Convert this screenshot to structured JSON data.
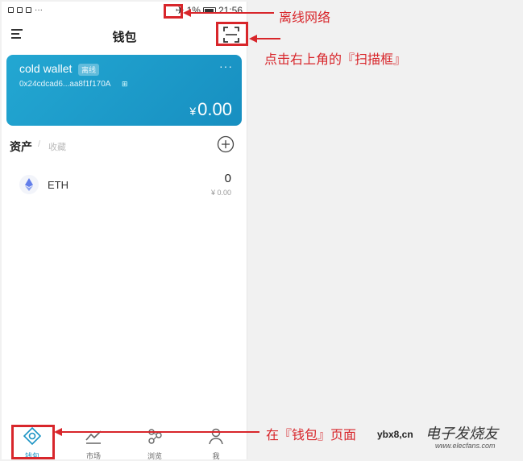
{
  "status_bar": {
    "left_icons": [
      "sim-icon",
      "message-icon",
      "image-icon"
    ],
    "dots": "···",
    "signal": "1%",
    "time": "21:56"
  },
  "header": {
    "title": "钱包"
  },
  "card": {
    "name": "cold wallet",
    "badge": "离线",
    "address": "0x24cdcad6...aa8f1f170A",
    "qr_label": "⊞",
    "more": "···",
    "currency": "¥",
    "balance": "0.00",
    "color": "#1b9bcb"
  },
  "assets": {
    "tab_assets": "资产",
    "separator": "/",
    "tab_collect": "收藏",
    "items": [
      {
        "name": "ETH",
        "amount": "0",
        "value": "¥ 0.00"
      }
    ]
  },
  "nav": {
    "items": [
      {
        "label": "钱包",
        "icon": "wallet-icon",
        "active": true
      },
      {
        "label": "市场",
        "icon": "chart-icon"
      },
      {
        "label": "浏览",
        "icon": "browse-icon"
      },
      {
        "label": "我",
        "icon": "user-icon"
      }
    ]
  },
  "annotations": {
    "offline": "离线网络",
    "scan": "点击右上角的『扫描框』",
    "wallet_page": "在『钱包』页面",
    "color": "#d8262b"
  },
  "watermark": {
    "prefix": "ybx8,cn",
    "logo": "电子发烧友",
    "url": "www.elecfans.com"
  }
}
